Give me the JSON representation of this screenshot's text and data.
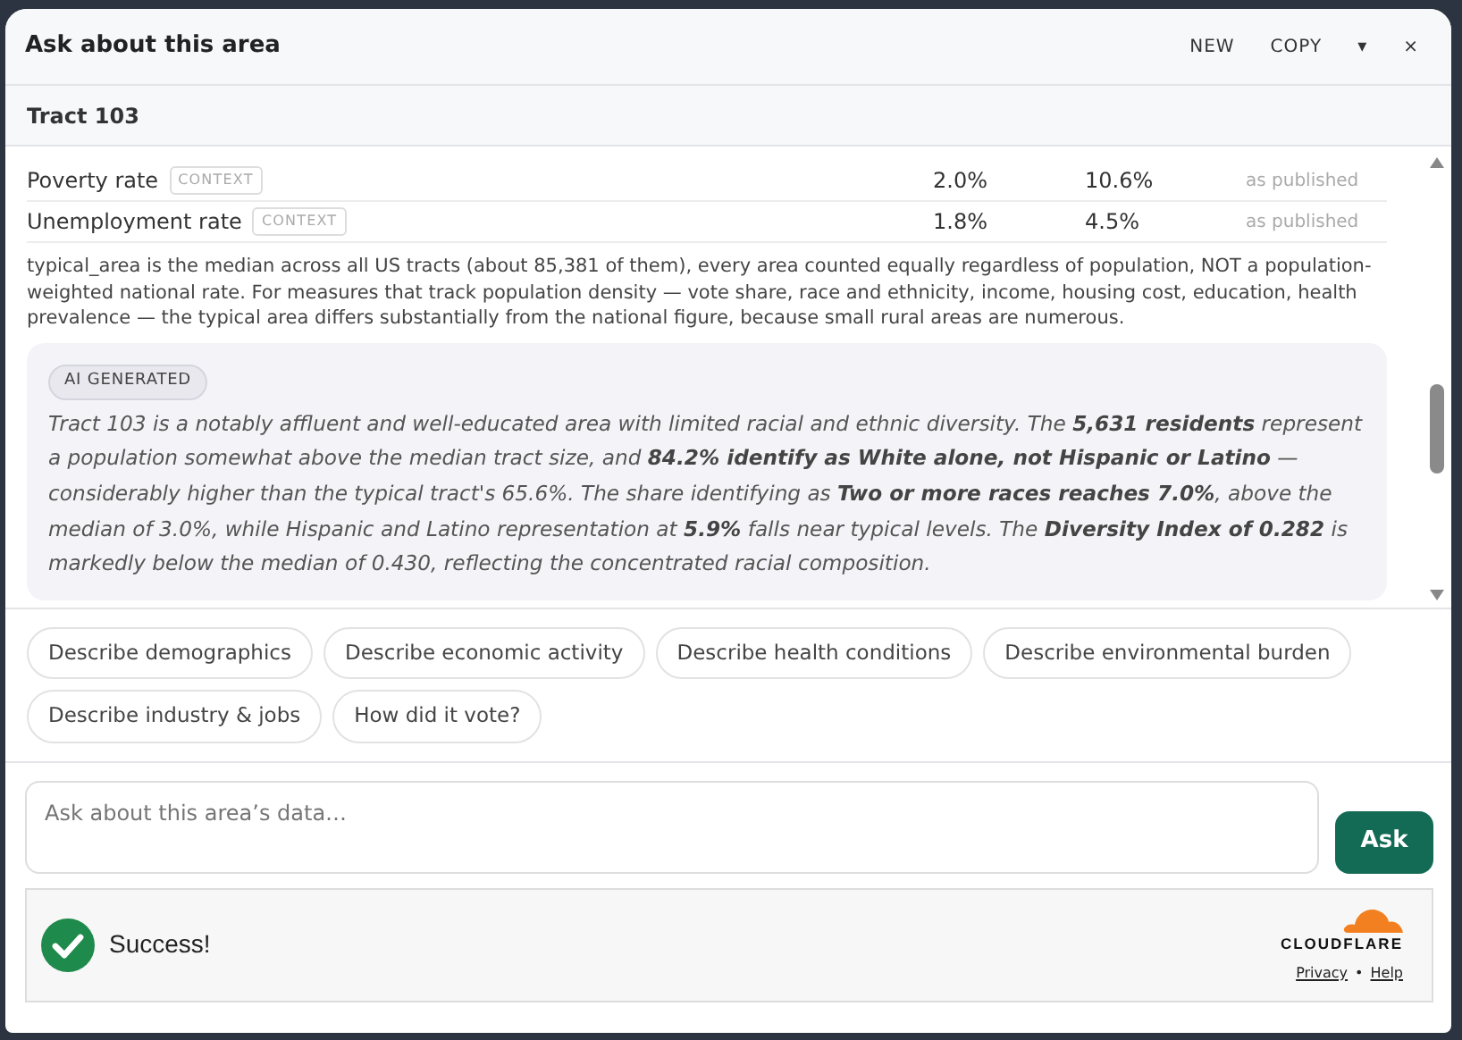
{
  "window": {
    "title": "Ask about this area",
    "actions": [
      "NEW",
      "COPY",
      "▾",
      "×"
    ]
  },
  "area": {
    "name": "Tract 103"
  },
  "rows": [
    {
      "label": "Poverty rate",
      "tag": "CONTEXT",
      "value": "2.0%",
      "typical": "10.6%",
      "note": "as published"
    },
    {
      "label": "Unemployment rate",
      "tag": "CONTEXT",
      "value": "1.8%",
      "typical": "4.5%",
      "note": "as published"
    }
  ],
  "footnote": "typical_area is the median across all US tracts (about 85,381 of them), every area counted equally regardless of population, NOT a population-weighted national rate. For measures that track population density — vote share, race and ethnicity, income, housing cost, education, health prevalence — the typical area differs substantially from the national figure, because small rural areas are numerous.",
  "answer": {
    "badge": "AI GENERATED",
    "text": "Tract 103 is a notably affluent and well-educated area with limited racial and ethnic diversity. The **5,631 residents** represent a population somewhat above the median tract size, and **84.2% identify as White alone, not Hispanic or Latino** —considerably higher than the typical tract's 65.6%. The share identifying as **Two or more races reaches 7.0%**, above the median of 3.0%, while Hispanic and Latino representation at **5.9%** falls near typical levels. The **Diversity Index of 0.282** is markedly below the median of 0.430, reflecting the concentrated racial composition."
  },
  "suggestions": [
    "Describe demographics",
    "Describe economic activity",
    "Describe health conditions",
    "Describe environmental burden",
    "Describe industry & jobs",
    "How did it vote?"
  ],
  "input": {
    "placeholder": "Ask about this area’s data…",
    "button": "Ask"
  },
  "captcha": {
    "status": "Success!",
    "brand": "CLOUDFLARE",
    "links": [
      "Privacy",
      "Help"
    ],
    "separator": "•"
  }
}
